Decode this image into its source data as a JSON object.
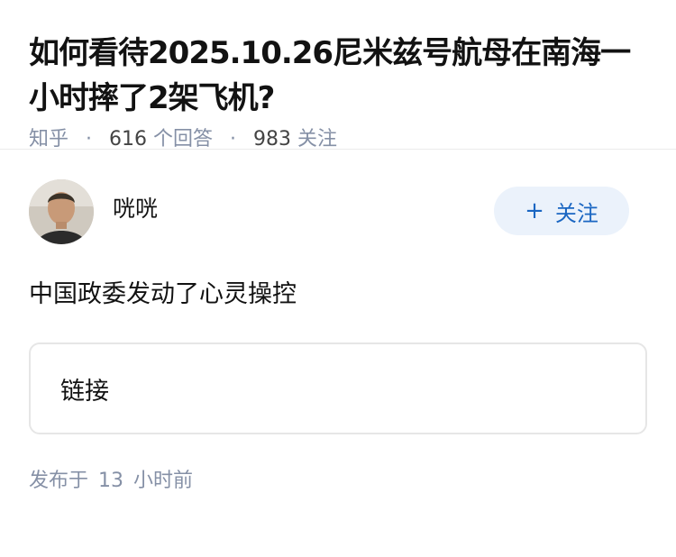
{
  "question": {
    "title": "如何看待2025.10.26尼米兹号航母在南海一小时摔了2架飞机?",
    "source": "知乎",
    "answer_count": "616",
    "answer_label": "个回答",
    "follow_count": "983",
    "follow_label": "关注"
  },
  "answer": {
    "author_name": "咣咣",
    "follow_button_label": "关注",
    "follow_button_icon": "plus-icon",
    "text": "中国政委发动了心灵操控",
    "link_label": "链接",
    "published_prefix": "发布于",
    "published_value": "13",
    "published_suffix": "小时前"
  },
  "colors": {
    "title": "#121212",
    "meta": "#8590a6",
    "follow_button_bg": "#ebf2fb",
    "follow_button_text": "#1a66c2"
  }
}
